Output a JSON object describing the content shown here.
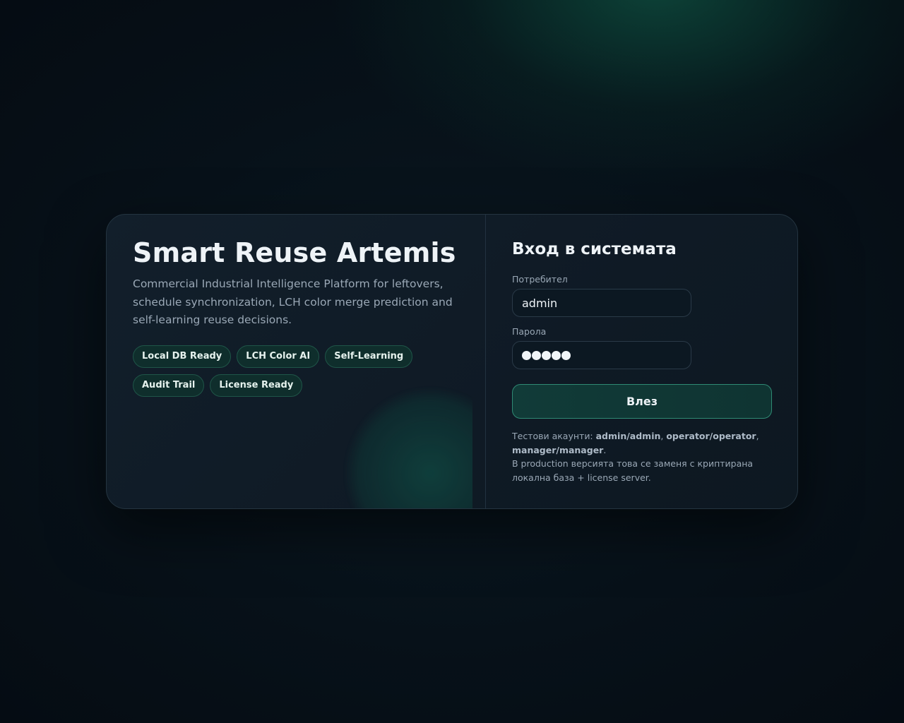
{
  "brand": {
    "title": "Smart Reuse Artemis",
    "description": "Commercial Industrial Intelligence Platform for leftovers, schedule synchronization, LCH color merge prediction and self-learning reuse decisions.",
    "chips": [
      "Local DB Ready",
      "LCH Color AI",
      "Self-Learning",
      "Audit Trail",
      "License Ready"
    ]
  },
  "login": {
    "title": "Вход в системата",
    "username_label": "Потребител",
    "username_value": "admin",
    "password_label": "Парола",
    "password_mask_count": 5,
    "submit_label": "Влез",
    "note": {
      "prefix": "Тестови акаунти: ",
      "account_1": "admin/admin",
      "sep_1": ", ",
      "account_2": "operator/operator",
      "sep_2": ",",
      "account_3": "manager/manager",
      "end": ".",
      "production_line": "В production версията това се заменя с криптирана локална база + license server."
    }
  },
  "colors": {
    "accent": "#2f8a74",
    "chip_bg": "#0f2e2c",
    "button_bg": "#113b38",
    "text_primary": "#eef3f7",
    "text_muted": "#9aa8b6"
  }
}
